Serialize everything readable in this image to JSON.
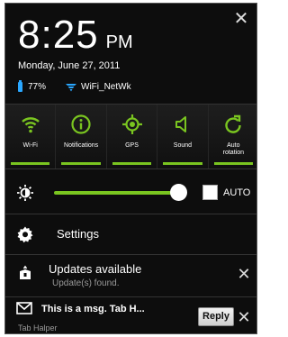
{
  "header": {
    "time": "8:25",
    "ampm": "PM",
    "date": "Monday, June 27, 2011",
    "battery": "77%",
    "wifi_network": "WiFi_NetWk"
  },
  "toggles": [
    {
      "label": "Wi-Fi",
      "icon": "wifi-icon",
      "on": true
    },
    {
      "label": "Notifications",
      "icon": "info-icon",
      "on": true
    },
    {
      "label": "GPS",
      "icon": "gps-icon",
      "on": true
    },
    {
      "label": "Sound",
      "icon": "sound-icon",
      "on": true
    },
    {
      "label_line1": "Auto",
      "label_line2": "rotation",
      "icon": "rotation-icon",
      "on": true
    }
  ],
  "brightness": {
    "level": 0.92,
    "auto_label": "AUTO"
  },
  "settings": {
    "label": "Settings"
  },
  "notifications": [
    {
      "title": "Updates available",
      "subtitle": "Update(s) found."
    },
    {
      "title": "This is a msg.  Tab H...",
      "app": "Tab Halper",
      "action": "Reply"
    }
  ],
  "colors": {
    "accent_green": "#7ac520",
    "battery_blue": "#2aa7ff",
    "background": "#0d0d0d"
  }
}
